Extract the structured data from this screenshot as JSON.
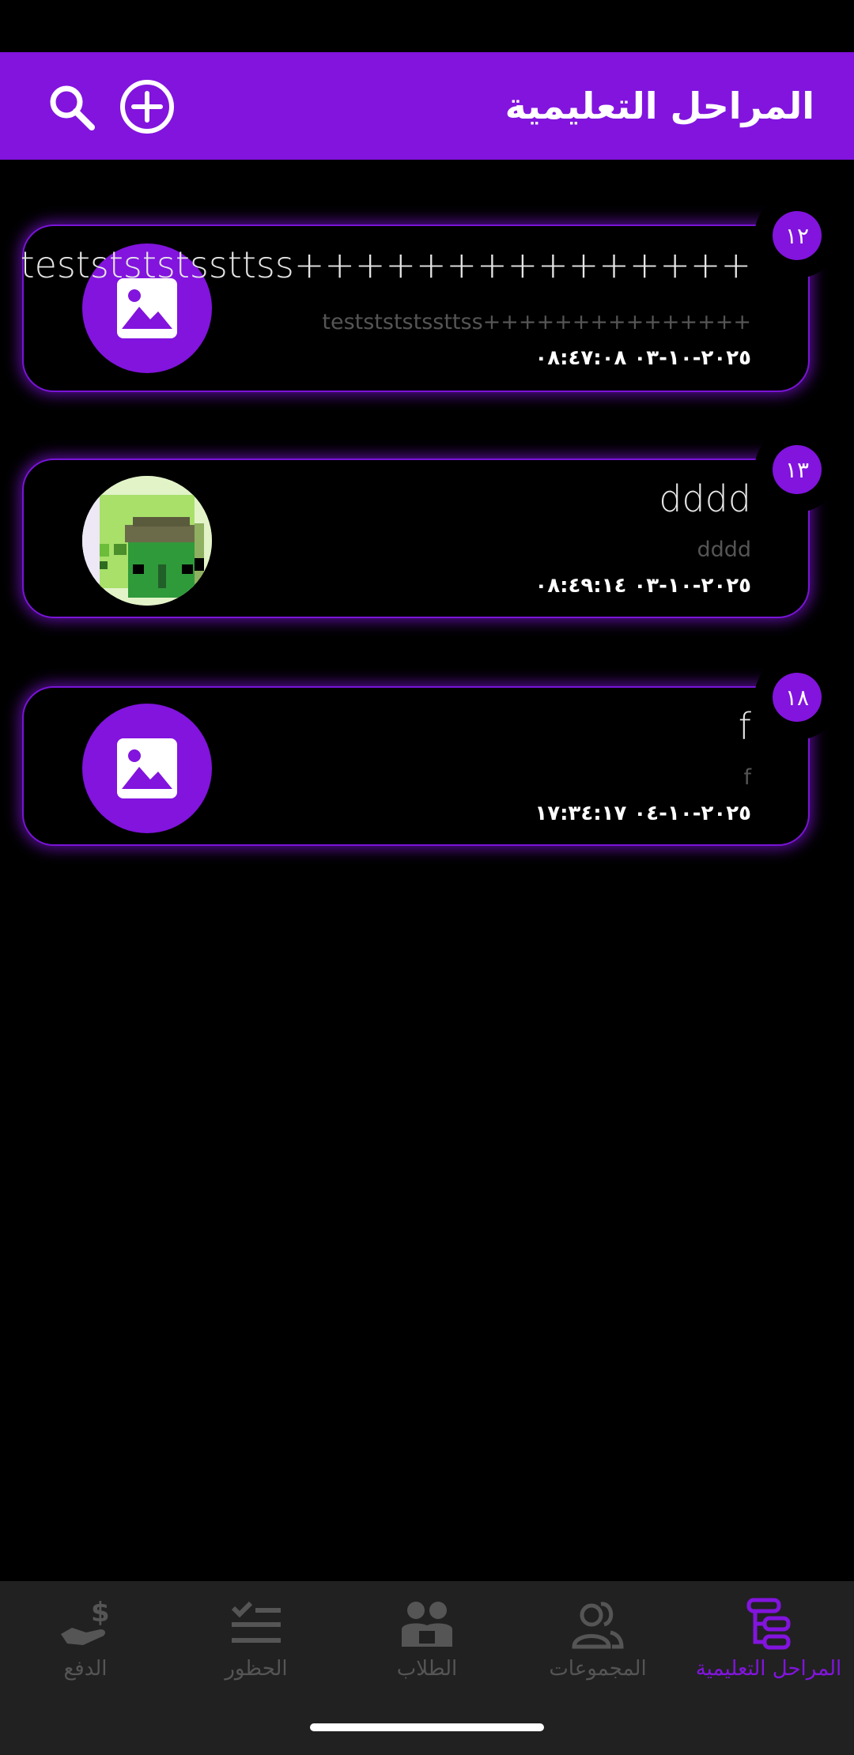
{
  "app_bar": {
    "title": "المراحل التعليمية",
    "search_icon": "search-icon",
    "add_icon": "add-circle-icon"
  },
  "colors": {
    "accent": "#8214DE",
    "background": "#000000",
    "nav_background": "#212121",
    "inactive": "#555555"
  },
  "cards": [
    {
      "badge": "١٢",
      "title": "teststststssttss+++++++++++++++",
      "subtitle": "teststststssttss+++++++++++++++",
      "date": "٢٠٢٥-١٠-٠٣ ٠٨:٤٧:٠٨",
      "avatar": "image-placeholder-icon"
    },
    {
      "badge": "١٣",
      "title": "dddd",
      "subtitle": "dddd",
      "date": "٢٠٢٥-١٠-٠٣ ٠٨:٤٩:١٤",
      "avatar": "pixel-art-avatar"
    },
    {
      "badge": "١٨",
      "title": "f",
      "subtitle": "f",
      "date": "٢٠٢٥-١٠-٠٤ ١٧:٣٤:١٧",
      "avatar": "image-placeholder-icon"
    }
  ],
  "bottom_nav": {
    "items": [
      {
        "label": "المراحل التعليمية",
        "icon": "stages-icon",
        "active": true
      },
      {
        "label": "المجموعات",
        "icon": "groups-icon",
        "active": false
      },
      {
        "label": "الطلاب",
        "icon": "students-icon",
        "active": false
      },
      {
        "label": "الحظور",
        "icon": "attendance-icon",
        "active": false
      },
      {
        "label": "الدفع",
        "icon": "payment-icon",
        "active": false
      }
    ]
  }
}
